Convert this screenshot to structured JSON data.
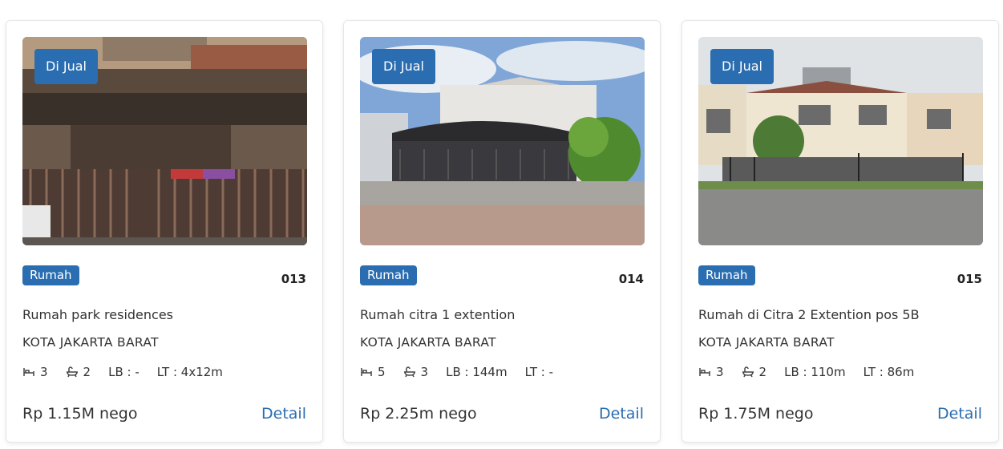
{
  "listings": [
    {
      "status": "Di Jual",
      "type": "Rumah",
      "code": "013",
      "title": "Rumah park residences",
      "city": "KOTA JAKARTA BARAT",
      "beds": "3",
      "baths": "2",
      "lb": "LB : -",
      "lt": "LT : 4x12m",
      "price": "Rp 1.15M nego",
      "detail_label": "Detail"
    },
    {
      "status": "Di Jual",
      "type": "Rumah",
      "code": "014",
      "title": "Rumah citra 1 extention",
      "city": "KOTA JAKARTA BARAT",
      "beds": "5",
      "baths": "3",
      "lb": "LB : 144m",
      "lt": "LT : -",
      "price": "Rp 2.25m nego",
      "detail_label": "Detail"
    },
    {
      "status": "Di Jual",
      "type": "Rumah",
      "code": "015",
      "title": "Rumah di Citra 2 Extention pos 5B",
      "city": "KOTA JAKARTA BARAT",
      "beds": "3",
      "baths": "2",
      "lb": "LB : 110m",
      "lt": "LT : 86m",
      "price": "Rp 1.75M nego",
      "detail_label": "Detail"
    }
  ],
  "colors": {
    "accent": "#2a6db0",
    "text": "#333333"
  },
  "icons": {
    "beds": "bed-icon",
    "baths": "bathtub-icon"
  }
}
